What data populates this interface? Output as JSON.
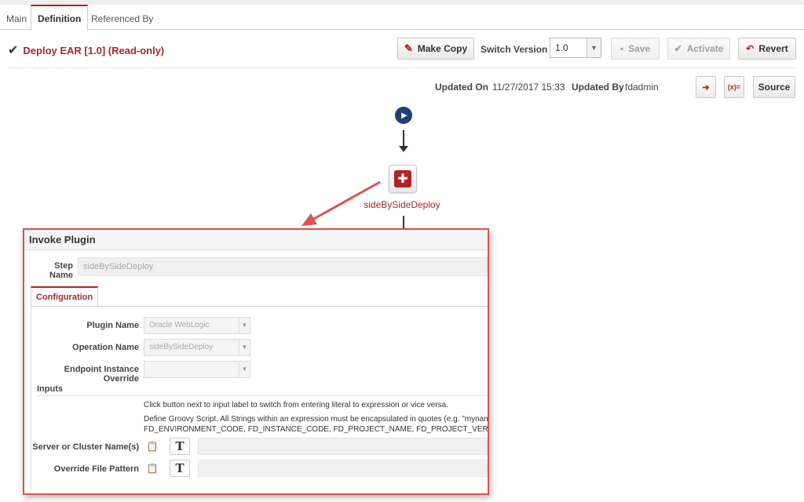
{
  "tabs": [
    {
      "label": "Main"
    },
    {
      "label": "Definition"
    },
    {
      "label": "Referenced By"
    }
  ],
  "header": {
    "title": "Deploy EAR [1.0] (Read-only)",
    "check_icon": "checkmark-icon"
  },
  "toolbar": {
    "make_copy": "Make Copy",
    "switch_version_label": "Switch Version",
    "version_value": "1.0",
    "save": "Save",
    "activate": "Activate",
    "revert": "Revert"
  },
  "meta": {
    "updated_on_label": "Updated On",
    "updated_on_value": "11/27/2017 15:33",
    "updated_by_label": "Updated By",
    "updated_by_value": "fdadmin",
    "var_btn": "(x)=",
    "source": "Source"
  },
  "flow": {
    "node_label": "sideBySideDeploy"
  },
  "panel": {
    "title": "Invoke Plugin",
    "step_name_label": "Step Name",
    "step_name_value": "sideBySideDeploy",
    "tab_configuration": "Configuration",
    "plugin_name_label": "Plugin Name",
    "plugin_name_value": "Oracle WebLogic",
    "operation_name_label": "Operation Name",
    "operation_name_value": "sideBySideDeploy",
    "endpoint_label": "Endpoint Instance Override",
    "endpoint_value": "",
    "inputs_label": "Inputs",
    "note1": "Click button next to input label to switch from entering literal to expression or vice versa.",
    "note2": "Define Groovy Script. All Strings within an expression must be encapsulated in quotes (e.g. \"myname\"). Nume",
    "note3": "FD_ENVIRONMENT_CODE, FD_INSTANCE_CODE, FD_PROJECT_NAME, FD_PROJECT_VERSION. Click the Va",
    "server_label": "Server or Cluster Name(s)",
    "override_label": "Override File Pattern",
    "t_glyph": "T"
  },
  "colors": {
    "accent": "#b22222",
    "highlight_border": "#d9534f",
    "start_node": "#1f3f7a"
  }
}
